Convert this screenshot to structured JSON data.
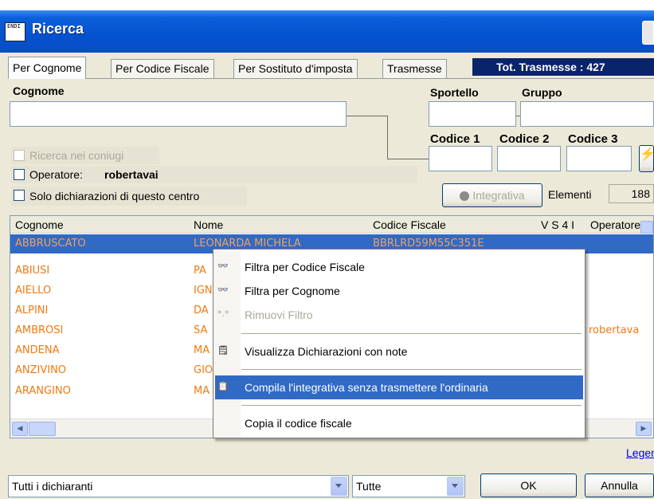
{
  "window": {
    "title": "Ricerca",
    "icon_text": "ENDI"
  },
  "tabs": [
    {
      "label": "Per Cognome"
    },
    {
      "label": "Per Codice Fiscale"
    },
    {
      "label": "Per Sostituto d'imposta"
    },
    {
      "label": "Trasmesse"
    }
  ],
  "total_badge": "Tot. Trasmesse : 427",
  "form": {
    "cognome_label": "Cognome",
    "cognome_value": "",
    "sportello_label": "Sportello",
    "gruppo_label": "Gruppo",
    "codice1_label": "Codice 1",
    "codice2_label": "Codice 2",
    "codice3_label": "Codice 3",
    "ricerca_coniugi_label": "Ricerca nei coniugi",
    "operatore_label": "Operatore:",
    "operatore_value": "robertavai",
    "solo_centro_label": "Solo dichiarazioni di questo centro",
    "integrativa_button": "Integrativa",
    "elementi_label": "Elementi",
    "elementi_value": "188"
  },
  "table": {
    "columns": [
      "Cognome",
      "Nome",
      "Codice Fiscale",
      "V S 4 I",
      "Operatore"
    ],
    "rows": [
      {
        "cognome": "ABBRUSCATO",
        "nome": "LEONARDA MICHELA",
        "cf": "BBRLRD59M55C351E",
        "op": ""
      },
      {
        "cognome": "ABIUSI",
        "nome": "PA",
        "cf": "",
        "op": ""
      },
      {
        "cognome": "AIELLO",
        "nome": "IGN",
        "cf": "",
        "op": ""
      },
      {
        "cognome": "ALPINI",
        "nome": "DA",
        "cf": "",
        "op": ""
      },
      {
        "cognome": "AMBROSI",
        "nome": "SA",
        "cf": "",
        "op": "robertava"
      },
      {
        "cognome": "ANDENA",
        "nome": "MA",
        "cf": "",
        "op": ""
      },
      {
        "cognome": "ANZIVINO",
        "nome": "GIO",
        "cf": "",
        "op": ""
      },
      {
        "cognome": "ARANGINO",
        "nome": "MA",
        "cf": "",
        "op": ""
      }
    ]
  },
  "context_menu": {
    "items": [
      {
        "label": "Filtra per Codice Fiscale",
        "icon": "glasses-icon",
        "glyph": "👓",
        "disabled": false
      },
      {
        "label": "Filtra per Cognome",
        "icon": "glasses-icon",
        "glyph": "👓",
        "disabled": false
      },
      {
        "label": "Rimuovi Filtro",
        "icon": "wildcard-icon",
        "glyph": "*.*",
        "disabled": true
      },
      {
        "label": "Visualizza Dichiarazioni con note",
        "icon": "note-icon",
        "glyph": "🗒",
        "disabled": false
      },
      {
        "label": "Compila l'integrativa senza trasmettere l'ordinaria",
        "icon": "form-icon",
        "glyph": "📋",
        "disabled": false
      },
      {
        "label": "Copia il codice fiscale",
        "icon": "",
        "glyph": "",
        "disabled": false
      }
    ]
  },
  "footer": {
    "legend_link": "Legen",
    "dichiaranti_select": "Tutti i dichiaranti",
    "tutte_select": "Tutte",
    "ok_button": "OK",
    "annulla_button": "Annulla"
  },
  "colors": {
    "title_bar": "#0552d0",
    "selection": "#316ac5",
    "row_text": "#f07a10",
    "badge_bg": "#0a246a"
  }
}
